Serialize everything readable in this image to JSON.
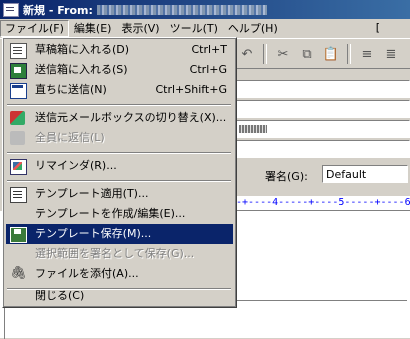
{
  "window": {
    "title": "新規 - From:"
  },
  "menubar": [
    {
      "label": "ファイル(F)",
      "name": "menu-file",
      "active": true
    },
    {
      "label": "編集(E)",
      "name": "menu-edit"
    },
    {
      "label": "表示(V)",
      "name": "menu-view"
    },
    {
      "label": "ツール(T)",
      "name": "menu-tools"
    },
    {
      "label": "ヘルプ(H)",
      "name": "menu-help"
    }
  ],
  "file_menu": {
    "items": [
      {
        "label": "草稿箱に入れる(D)",
        "shortcut": "Ctrl+T",
        "icon": "draft-icon"
      },
      {
        "label": "送信箱に入れる(S)",
        "shortcut": "Ctrl+G",
        "icon": "outbox-icon"
      },
      {
        "label": "直ちに送信(N)",
        "shortcut": "Ctrl+Shift+G",
        "icon": "send-icon"
      },
      {
        "label": "送信元メールボックスの切り替え(X)...",
        "shortcut": "",
        "icon": "switch-mailbox-icon"
      },
      {
        "label": "全員に返信(L)",
        "shortcut": "",
        "icon": "reply-all-icon",
        "disabled": true
      },
      {
        "label": "リマインダ(R)...",
        "shortcut": "",
        "icon": "reminder-icon"
      },
      {
        "label": "テンプレート適用(T)...",
        "shortcut": "",
        "icon": "template-icon"
      },
      {
        "label": "テンプレートを作成/編集(E)...",
        "shortcut": "",
        "icon": ""
      },
      {
        "label": "テンプレート保存(M)...",
        "shortcut": "",
        "icon": "save-template-icon",
        "highlighted": true
      },
      {
        "label": "選択範囲を署名として保存(G)...",
        "shortcut": "",
        "icon": "",
        "disabled": true
      },
      {
        "label": "ファイルを添付(A)...",
        "shortcut": "",
        "icon": "paperclip-icon"
      },
      {
        "label": "閉じる(C)",
        "shortcut": "",
        "icon": ""
      }
    ]
  },
  "signature": {
    "label": "署名(G):",
    "value": "Default"
  },
  "ruler": {
    "text": "-+----4-----+----5-----+----6-----+"
  },
  "toolbar_icons": [
    "cut-icon",
    "copy-icon",
    "paste-icon",
    "align-left-icon",
    "align-center-icon"
  ],
  "menubar_right_text": "["
}
